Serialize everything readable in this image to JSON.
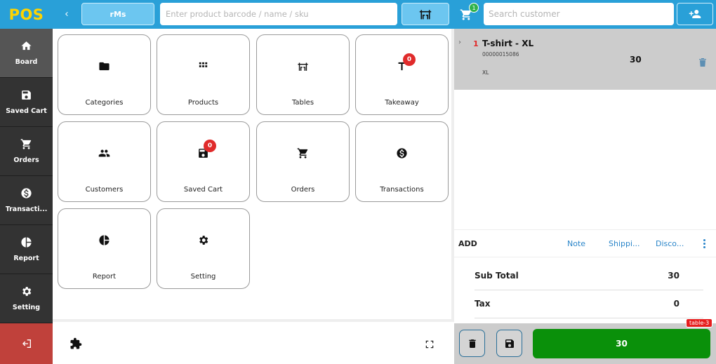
{
  "app": {
    "logo": "POS"
  },
  "sidebar": {
    "items": [
      {
        "label": "Board",
        "icon": "home-icon",
        "active": true
      },
      {
        "label": "Saved Cart",
        "icon": "save-icon"
      },
      {
        "label": "Orders",
        "icon": "cart-icon"
      },
      {
        "label": "Transacti...",
        "icon": "dollar-icon"
      },
      {
        "label": "Report",
        "icon": "pie-chart-icon"
      },
      {
        "label": "Setting",
        "icon": "gear-icon"
      }
    ],
    "logout_icon": "logout-icon"
  },
  "topbar": {
    "store_label": "rMs",
    "search_placeholder": "Enter product barcode / name / sku",
    "table_icon": "table-icon"
  },
  "tiles": [
    {
      "label": "Categories",
      "icon": "folder-icon"
    },
    {
      "label": "Products",
      "icon": "grid-icon"
    },
    {
      "label": "Tables",
      "icon": "table-icon"
    },
    {
      "label": "Takeaway",
      "icon": "takeaway-icon",
      "badge": "0"
    },
    {
      "label": "Customers",
      "icon": "people-icon"
    },
    {
      "label": "Saved Cart",
      "icon": "save-icon",
      "badge": "0"
    },
    {
      "label": "Orders",
      "icon": "cart-icon"
    },
    {
      "label": "Transactions",
      "icon": "dollar-icon"
    },
    {
      "label": "Report",
      "icon": "pie-chart-icon"
    },
    {
      "label": "Setting",
      "icon": "gear-icon"
    }
  ],
  "cart": {
    "badge": "1",
    "customer_search_placeholder": "Search customer",
    "item": {
      "qty": "1",
      "name": "T-shirt - XL",
      "sku": "00000015086",
      "variant": "XL",
      "price": "30"
    },
    "add_row": {
      "label": "ADD",
      "note": "Note",
      "shipping": "Shippi...",
      "discount": "Disco..."
    },
    "subtotal_label": "Sub Total",
    "subtotal_value": "30",
    "tax_label": "Tax",
    "tax_value": "0",
    "pay_amount": "30",
    "table_tag": "table-3"
  },
  "colors": {
    "accent": "#29a0d8",
    "sidebar": "#333333",
    "pay": "#0a900a",
    "badge": "#e02b2b",
    "logout": "#c0413b"
  }
}
